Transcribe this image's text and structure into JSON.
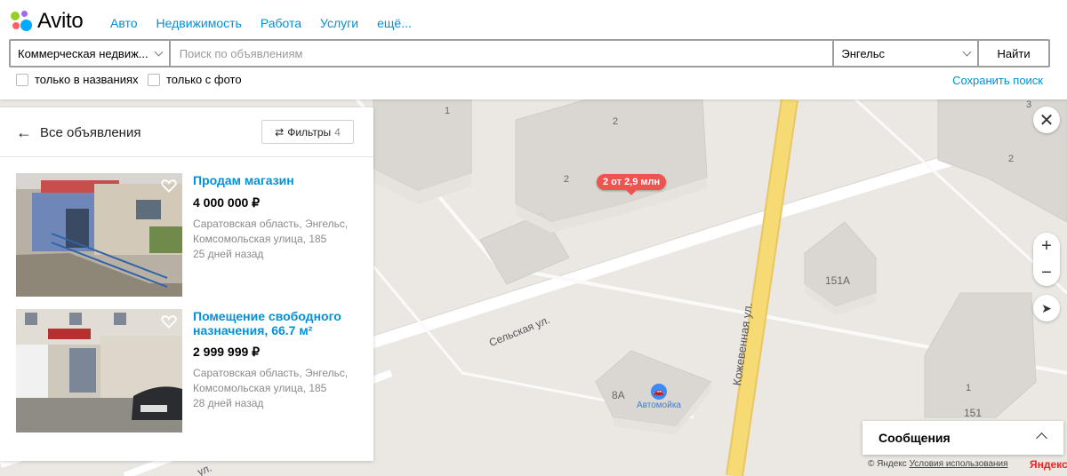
{
  "logo": {
    "text": "Avito"
  },
  "nav": [
    "Авто",
    "Недвижимость",
    "Работа",
    "Услуги",
    "ещё..."
  ],
  "search": {
    "category": "Коммерческая недвиж...",
    "query_placeholder": "Поиск по объявлениям",
    "city": "Энгельс",
    "submit": "Найти"
  },
  "filters": {
    "only_titles": "только в названиях",
    "only_photo": "только с фото",
    "save_search": "Сохранить поиск"
  },
  "panel": {
    "back_label": "Все объявления",
    "filters_label": "Фильтры",
    "filters_count": "4"
  },
  "listings": [
    {
      "title": "Продам магазин",
      "price": "4 000 000 ₽",
      "address": "Саратовская область, Энгельс, Комсомольская улица, 185",
      "date": "25 дней назад"
    },
    {
      "title": "Помещение свободного назначения, 66.7 м²",
      "price": "2 999 999 ₽",
      "address": "Саратовская область, Энгельс, Комсомольская улица, 185",
      "date": "28 дней назад"
    }
  ],
  "map": {
    "cluster": "2 от 2,9 млн",
    "streets": [
      "Сельская ул.",
      "Кожевенная ул.",
      "ул."
    ],
    "houses": [
      "1",
      "2",
      "2",
      "151А",
      "8А",
      "151",
      "1",
      "3",
      "2"
    ],
    "poi": "Автомойка"
  },
  "messages": {
    "label": "Сообщения"
  },
  "copyright": {
    "prefix": "© Яндекс",
    "terms": "Условия использования",
    "brand": "Яндекс"
  },
  "colors": {
    "accent": "#0091d9",
    "cluster": "#ef5350",
    "road": "#f6da74"
  }
}
